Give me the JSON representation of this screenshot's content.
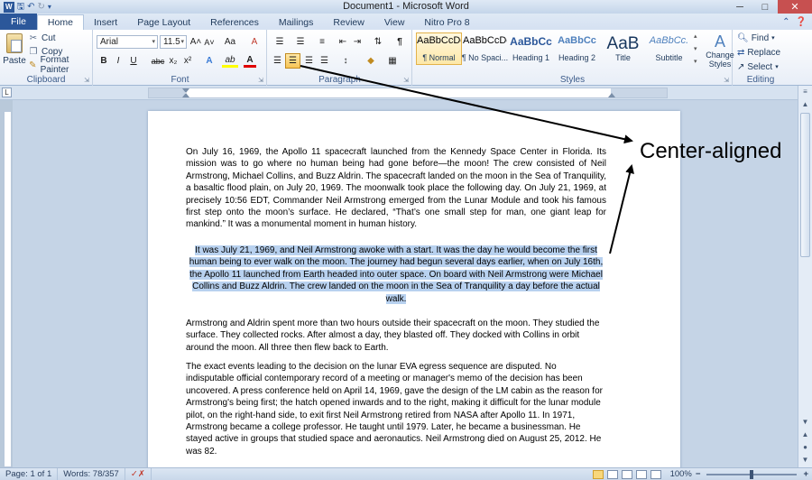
{
  "window": {
    "title": "Document1 - Microsoft Word",
    "qat_icons": [
      "word-icon",
      "save-icon",
      "undo-icon",
      "redo-icon",
      "customize-icon"
    ]
  },
  "tabs": [
    "File",
    "Home",
    "Insert",
    "Page Layout",
    "References",
    "Mailings",
    "Review",
    "View",
    "Nitro Pro 8"
  ],
  "active_tab": "Home",
  "ribbon": {
    "clipboard": {
      "label": "Clipboard",
      "paste": "Paste",
      "cut": "Cut",
      "copy": "Copy",
      "format_painter": "Format Painter"
    },
    "font": {
      "label": "Font",
      "font_name": "Arial",
      "font_size": "11.5",
      "bold": "B",
      "italic": "I",
      "underline": "U",
      "strike": "abc",
      "subscript": "x₂",
      "superscript": "x²",
      "text_effects": "A",
      "highlight": "ab",
      "font_color": "A",
      "grow": "A˄",
      "shrink": "A˅",
      "change_case": "Aa",
      "clear": "A"
    },
    "paragraph": {
      "label": "Paragraph",
      "active_alignment": "center"
    },
    "styles": {
      "label": "Styles",
      "tiles": [
        {
          "preview": "AaBbCcDc",
          "name": "¶ Normal"
        },
        {
          "preview": "AaBbCcDc",
          "name": "¶ No Spaci..."
        },
        {
          "preview": "AaBbCᴄ",
          "name": "Heading 1"
        },
        {
          "preview": "AaBbCc",
          "name": "Heading 2"
        },
        {
          "preview": "AaB",
          "name": "Title"
        },
        {
          "preview": "AaBbCc.",
          "name": "Subtitle"
        }
      ],
      "change_styles": "Change Styles"
    },
    "editing": {
      "label": "Editing",
      "find": "Find",
      "replace": "Replace",
      "select": "Select"
    }
  },
  "document": {
    "p1": "On July 16, 1969, the Apollo 11 spacecraft launched from the Kennedy Space Center in Florida. Its mission was to go where no human being had gone before—the moon! The crew consisted of Neil Armstrong, Michael Collins, and Buzz Aldrin. The spacecraft landed on the moon in the Sea of Tranquility, a basaltic flood plain, on July 20, 1969. The moonwalk took place the following day. On July 21, 1969, at precisely 10:56 EDT, Commander Neil Armstrong emerged from the Lunar Module and took his famous first step onto the moon’s surface. He declared, “That’s one small step for man, one giant leap for mankind.” It was a monumental moment in human history.",
    "p2": "It was July 21, 1969, and Neil Armstrong awoke with a start. It was the day he would become the first human being to ever walk on the moon. The journey had begun several days earlier, when on July 16th, the Apollo 11 launched from Earth headed into outer space. On board with Neil Armstrong were Michael Collins and Buzz Aldrin. The crew landed on the moon in the Sea of Tranquility a day before the actual walk.",
    "p3": "Armstrong and Aldrin spent more than two hours outside their spacecraft on the moon. They studied the surface. They collected rocks. After almost a day, they blasted off. They docked with Collins in orbit around the moon. All three then flew back to Earth.",
    "p4": "The exact events leading to the decision on the lunar EVA egress sequence are disputed. No indisputable official contemporary record of a meeting or manager's memo of the decision has been uncovered. A press conference held on April 14, 1969, gave the design of the LM cabin as the reason for Armstrong's being first; the hatch opened inwards and to the right, making it difficult for the lunar module pilot, on the right-hand side, to exit first Neil Armstrong retired from NASA after Apollo 11. In 1971, Armstrong became a college professor. He taught until 1979. Later, he became a businessman. He stayed active in groups that studied space and aeronautics. Neil Armstrong died on August 25, 2012. He was 82."
  },
  "status": {
    "page": "Page: 1 of 1",
    "words": "Words: 78/357",
    "zoom": "100%"
  },
  "annotation": {
    "text": "Center-aligned"
  },
  "colors": {
    "file_tab": "#2b579a",
    "selection": "#b8d1ef",
    "close_button": "#c75050"
  }
}
